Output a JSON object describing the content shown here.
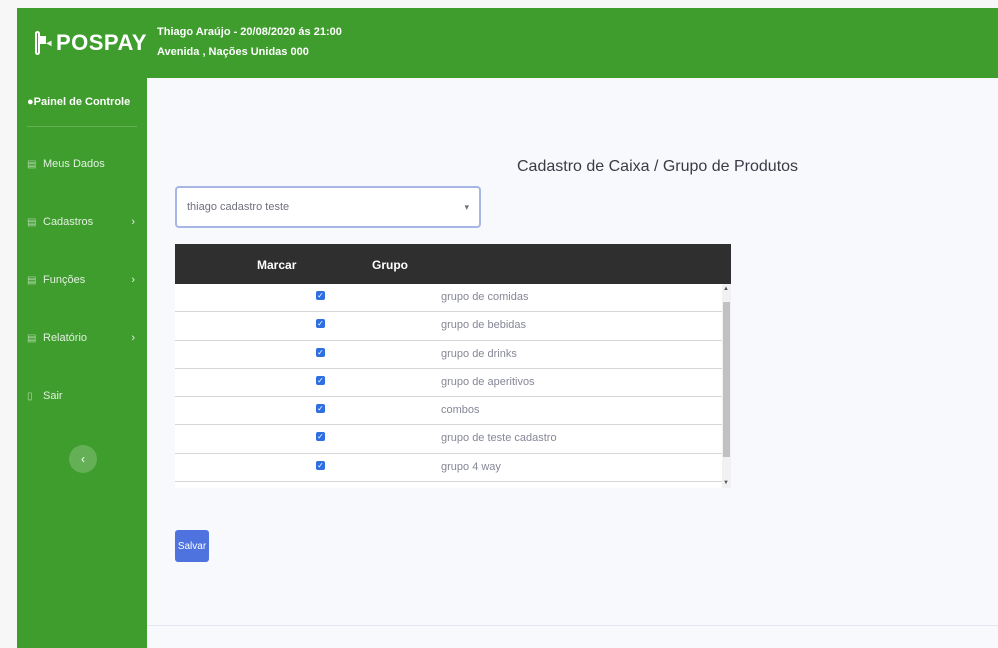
{
  "brand": {
    "name": "POSPAY"
  },
  "topbar": {
    "line1": "Thiago Araújo - 20/08/2020 ás 21:00",
    "line2": "Avenida , Nações Unidas 000"
  },
  "sidebar": {
    "dashboard": "Painel de Controle",
    "items": [
      {
        "label": "Meus Dados",
        "chevron": ""
      },
      {
        "label": "Cadastros",
        "chevron": "›"
      },
      {
        "label": "Funções",
        "chevron": "›"
      },
      {
        "label": "Relatório",
        "chevron": "›"
      },
      {
        "label": "Sair",
        "chevron": ""
      }
    ],
    "toggle": "‹"
  },
  "page": {
    "title": "Cadastro de Caixa / Grupo de Produtos",
    "select_value": "thiago cadastro teste",
    "save_label": "Salvar"
  },
  "table": {
    "headers": [
      "Marcar",
      "Grupo"
    ],
    "rows": [
      {
        "checked": true,
        "group": "grupo de comidas"
      },
      {
        "checked": true,
        "group": "grupo de bebidas"
      },
      {
        "checked": true,
        "group": "grupo de drinks"
      },
      {
        "checked": true,
        "group": "grupo de aperitivos"
      },
      {
        "checked": true,
        "group": "combos"
      },
      {
        "checked": true,
        "group": "grupo de teste cadastro"
      },
      {
        "checked": true,
        "group": "grupo 4 way"
      },
      {
        "checked": false,
        "group": ""
      }
    ]
  },
  "colors": {
    "brand_green": "#3f9d2e",
    "primary_blue": "#4e73df",
    "header_dark": "#2f2f2f"
  }
}
